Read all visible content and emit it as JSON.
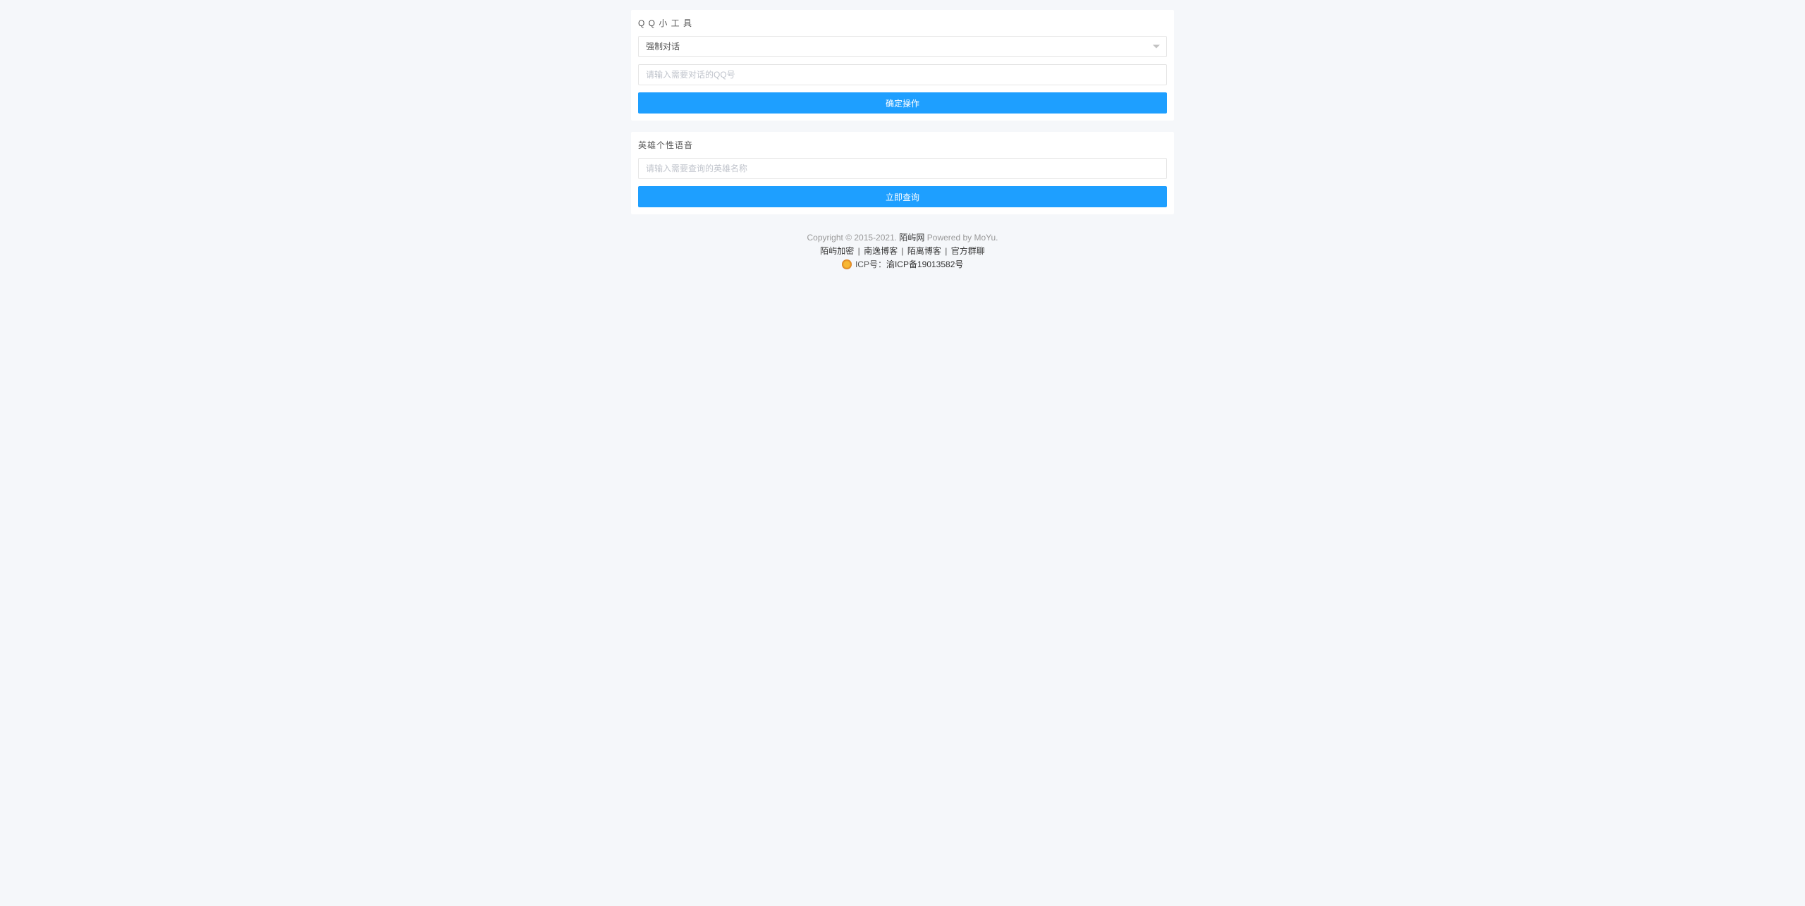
{
  "panel1": {
    "title": "Q Q 小 工 具",
    "select_value": "强制对话",
    "input_placeholder": "请输入需要对话的QQ号",
    "button_label": "确定操作"
  },
  "panel2": {
    "title": "英雄个性语音",
    "input_placeholder": "请输入需要查询的英雄名称",
    "button_label": "立即查询"
  },
  "footer": {
    "copyright_prefix": "Copyright © 2015-2021. ",
    "site_name": "陌屿网",
    "copyright_suffix": " Powered by MoYu.",
    "links": [
      "陌屿加密",
      "南逸博客",
      "陌离博客",
      "官方群聊"
    ],
    "separator": " | ",
    "icp_label": " ICP号：",
    "icp_number": "渝ICP备19013582号"
  }
}
